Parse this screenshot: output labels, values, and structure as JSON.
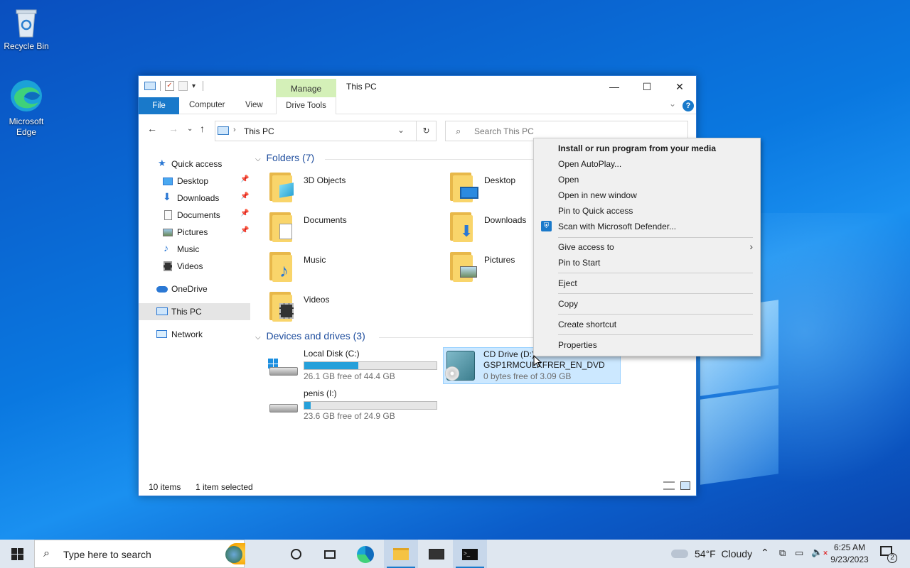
{
  "desktop": {
    "icons": [
      {
        "label": "Recycle Bin"
      },
      {
        "label": "Microsoft Edge"
      }
    ]
  },
  "window": {
    "title": "This PC",
    "manage_tab": "Manage",
    "ribbon_tabs": {
      "file": "File",
      "computer": "Computer",
      "view": "View",
      "drive_tools": "Drive Tools"
    },
    "address": "This PC",
    "search_placeholder": "Search This PC",
    "sidebar": {
      "quick_access": "Quick access",
      "desktop": "Desktop",
      "downloads": "Downloads",
      "documents": "Documents",
      "pictures": "Pictures",
      "music": "Music",
      "videos": "Videos",
      "onedrive": "OneDrive",
      "this_pc": "This PC",
      "network": "Network"
    },
    "folders_header": "Folders (7)",
    "folders": [
      "3D Objects",
      "Desktop",
      "Documents",
      "Downloads",
      "Music",
      "Pictures",
      "Videos"
    ],
    "devices_header": "Devices and drives (3)",
    "drives": [
      {
        "name": "Local Disk (C:)",
        "free": "26.1 GB free of 44.4 GB",
        "used_fraction": 0.41
      },
      {
        "name": "CD Drive (D:)",
        "label": "GSP1RMCULXFRER_EN_DVD",
        "free": "0 bytes free of 3.09 GB"
      },
      {
        "name": "penis (I:)",
        "free": "23.6 GB free of 24.9 GB",
        "used_fraction": 0.05
      }
    ],
    "status": {
      "items": "10 items",
      "selected": "1 item selected"
    }
  },
  "context_menu": {
    "items": [
      "Install or run program from your media",
      "Open AutoPlay...",
      "Open",
      "Open in new window",
      "Pin to Quick access",
      "Scan with Microsoft Defender...",
      "Give access to",
      "Pin to Start",
      "Eject",
      "Copy",
      "Create shortcut",
      "Properties"
    ]
  },
  "taskbar": {
    "search_placeholder": "Type here to search",
    "weather": "54°F  Cloudy",
    "time": "6:25 AM",
    "date": "9/23/2023",
    "notification_count": "2"
  }
}
